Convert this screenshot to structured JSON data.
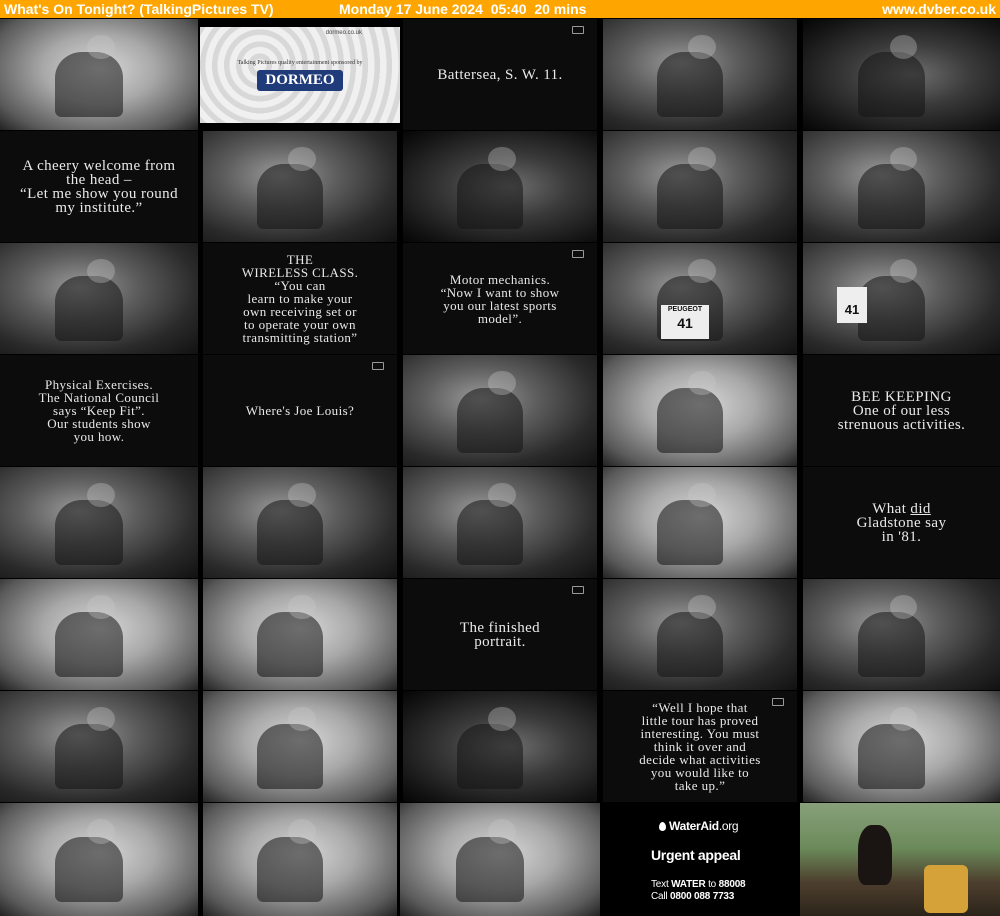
{
  "header": {
    "channel_title": "What's On Tonight? (TalkingPictures TV)",
    "datetime": "Monday 17 June 2024  05:40  20 mins",
    "site": "www.dvber.co.uk"
  },
  "colors": {
    "header_bg": "#ffa500",
    "page_bg": "#000000"
  },
  "ads": {
    "sponsor": {
      "url": "dormeo.co.uk",
      "tagline": "Talking Pictures quality entertainment sponsored by",
      "brand": "DORMEO"
    },
    "wateraid": {
      "logo_text": "WaterAid",
      "logo_suffix": ".org",
      "headline": "Urgent appeal",
      "text_line_prefix": "Text ",
      "text_keyword": "WATER",
      "text_line_mid": " to ",
      "text_number": "88008",
      "call_prefix": "Call ",
      "call_number": "0800 088 7733"
    }
  },
  "cards": {
    "battersea": "Battersea, S. W. 11.",
    "welcome": "A cheery welcome from\nthe head –\n“Let me show you round\nmy institute.”",
    "wireless": "THE\nWIRELESS CLASS.\n“You can\nlearn to make your\nown receiving set or\nto operate your own\ntransmitting station”",
    "motor": "Motor mechanics.\n“Now I want to show\nyou our latest sports\nmodel”.",
    "physical": "Physical Exercises.\nThe National Council\nsays “Keep Fit”.\nOur students show\nyou how.",
    "joe": "Where's Joe Louis?",
    "bee": "BEE KEEPING\nOne of our less\nstrenuous activities.",
    "gladstone_pre": "What ",
    "gladstone_did": "did",
    "gladstone_rest": "Gladstone say\nin '81.",
    "portrait": "The finished\nportrait.",
    "tour": "“Well I hope that\nlittle tour has proved\ninteresting. You must\nthink it over and\ndecide what activities\nyou would like to\ntake up.”"
  },
  "car_plate": {
    "make": "PEUGEOT",
    "number": "41"
  }
}
